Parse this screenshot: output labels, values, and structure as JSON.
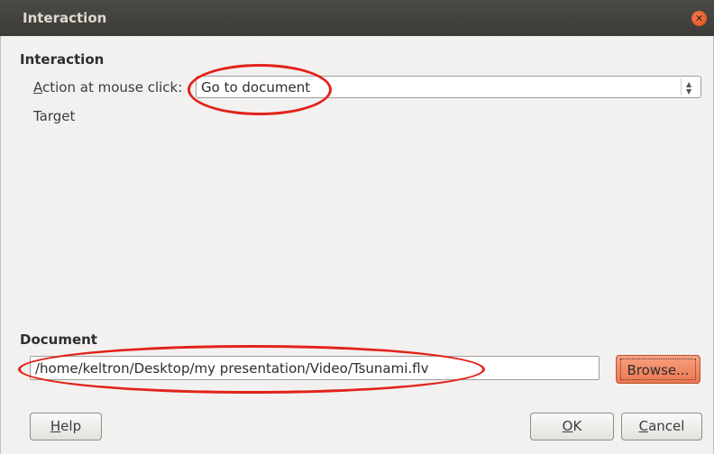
{
  "window": {
    "title": "Interaction",
    "close_icon": "close-icon",
    "close_glyph": "✕"
  },
  "interaction": {
    "heading": "Interaction",
    "action_label_access": "A",
    "action_label_rest": "ction at mouse click:",
    "action_value": "Go to document",
    "target_label": "Target"
  },
  "document": {
    "heading": "Document",
    "path": "/home/keltron/Desktop/my presentation/Video/Tsunami.flv",
    "browse_label": "Browse..."
  },
  "buttons": {
    "help_access": "H",
    "help_rest": "elp",
    "ok_access": "O",
    "ok_rest": "K",
    "cancel_access": "C",
    "cancel_rest": "ancel"
  },
  "colors": {
    "highlight_ellipse": "#e2231a",
    "browse_accent": "#ec7650",
    "titlebar": "#3c3b37"
  }
}
